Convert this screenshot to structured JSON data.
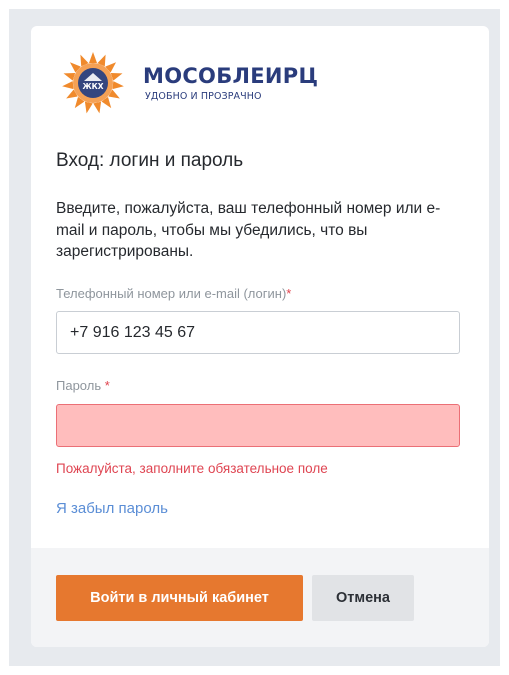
{
  "brand": {
    "name": "МОСОБЛЕИРЦ",
    "tagline": "УДОБНО И ПРОЗРАЧНО",
    "badge": "ЖКХ",
    "logo_icon": "sun-house-emblem",
    "colors": {
      "brand_blue": "#2a3c7c",
      "logo_orange": "#f08a2c",
      "badge_blue": "#34467f"
    }
  },
  "login": {
    "title": "Вход: логин и пароль",
    "intro": "Введите, пожалуйста, ваш телефонный номер или  e-mail и пароль, чтобы мы убедились, что вы зарегистрированы.",
    "fields": {
      "login": {
        "label": "Телефонный номер или e-mail (логин)",
        "required_mark": "*",
        "value": "+7 916 123 45 67",
        "placeholder": ""
      },
      "password": {
        "label": "Пароль",
        "required_mark": "*",
        "value": "",
        "placeholder": "",
        "state": "error"
      }
    },
    "error_message": "Пожалуйста, заполните обязательное поле",
    "forgot_password_link": "Я забыл пароль"
  },
  "actions": {
    "submit_label": "Войти в личный кабинет",
    "cancel_label": "Отмена"
  },
  "colors": {
    "accent": "#e6782f",
    "error": "#df4552",
    "error_field_bg": "#ffbdbd",
    "link": "#5b8ed6"
  }
}
